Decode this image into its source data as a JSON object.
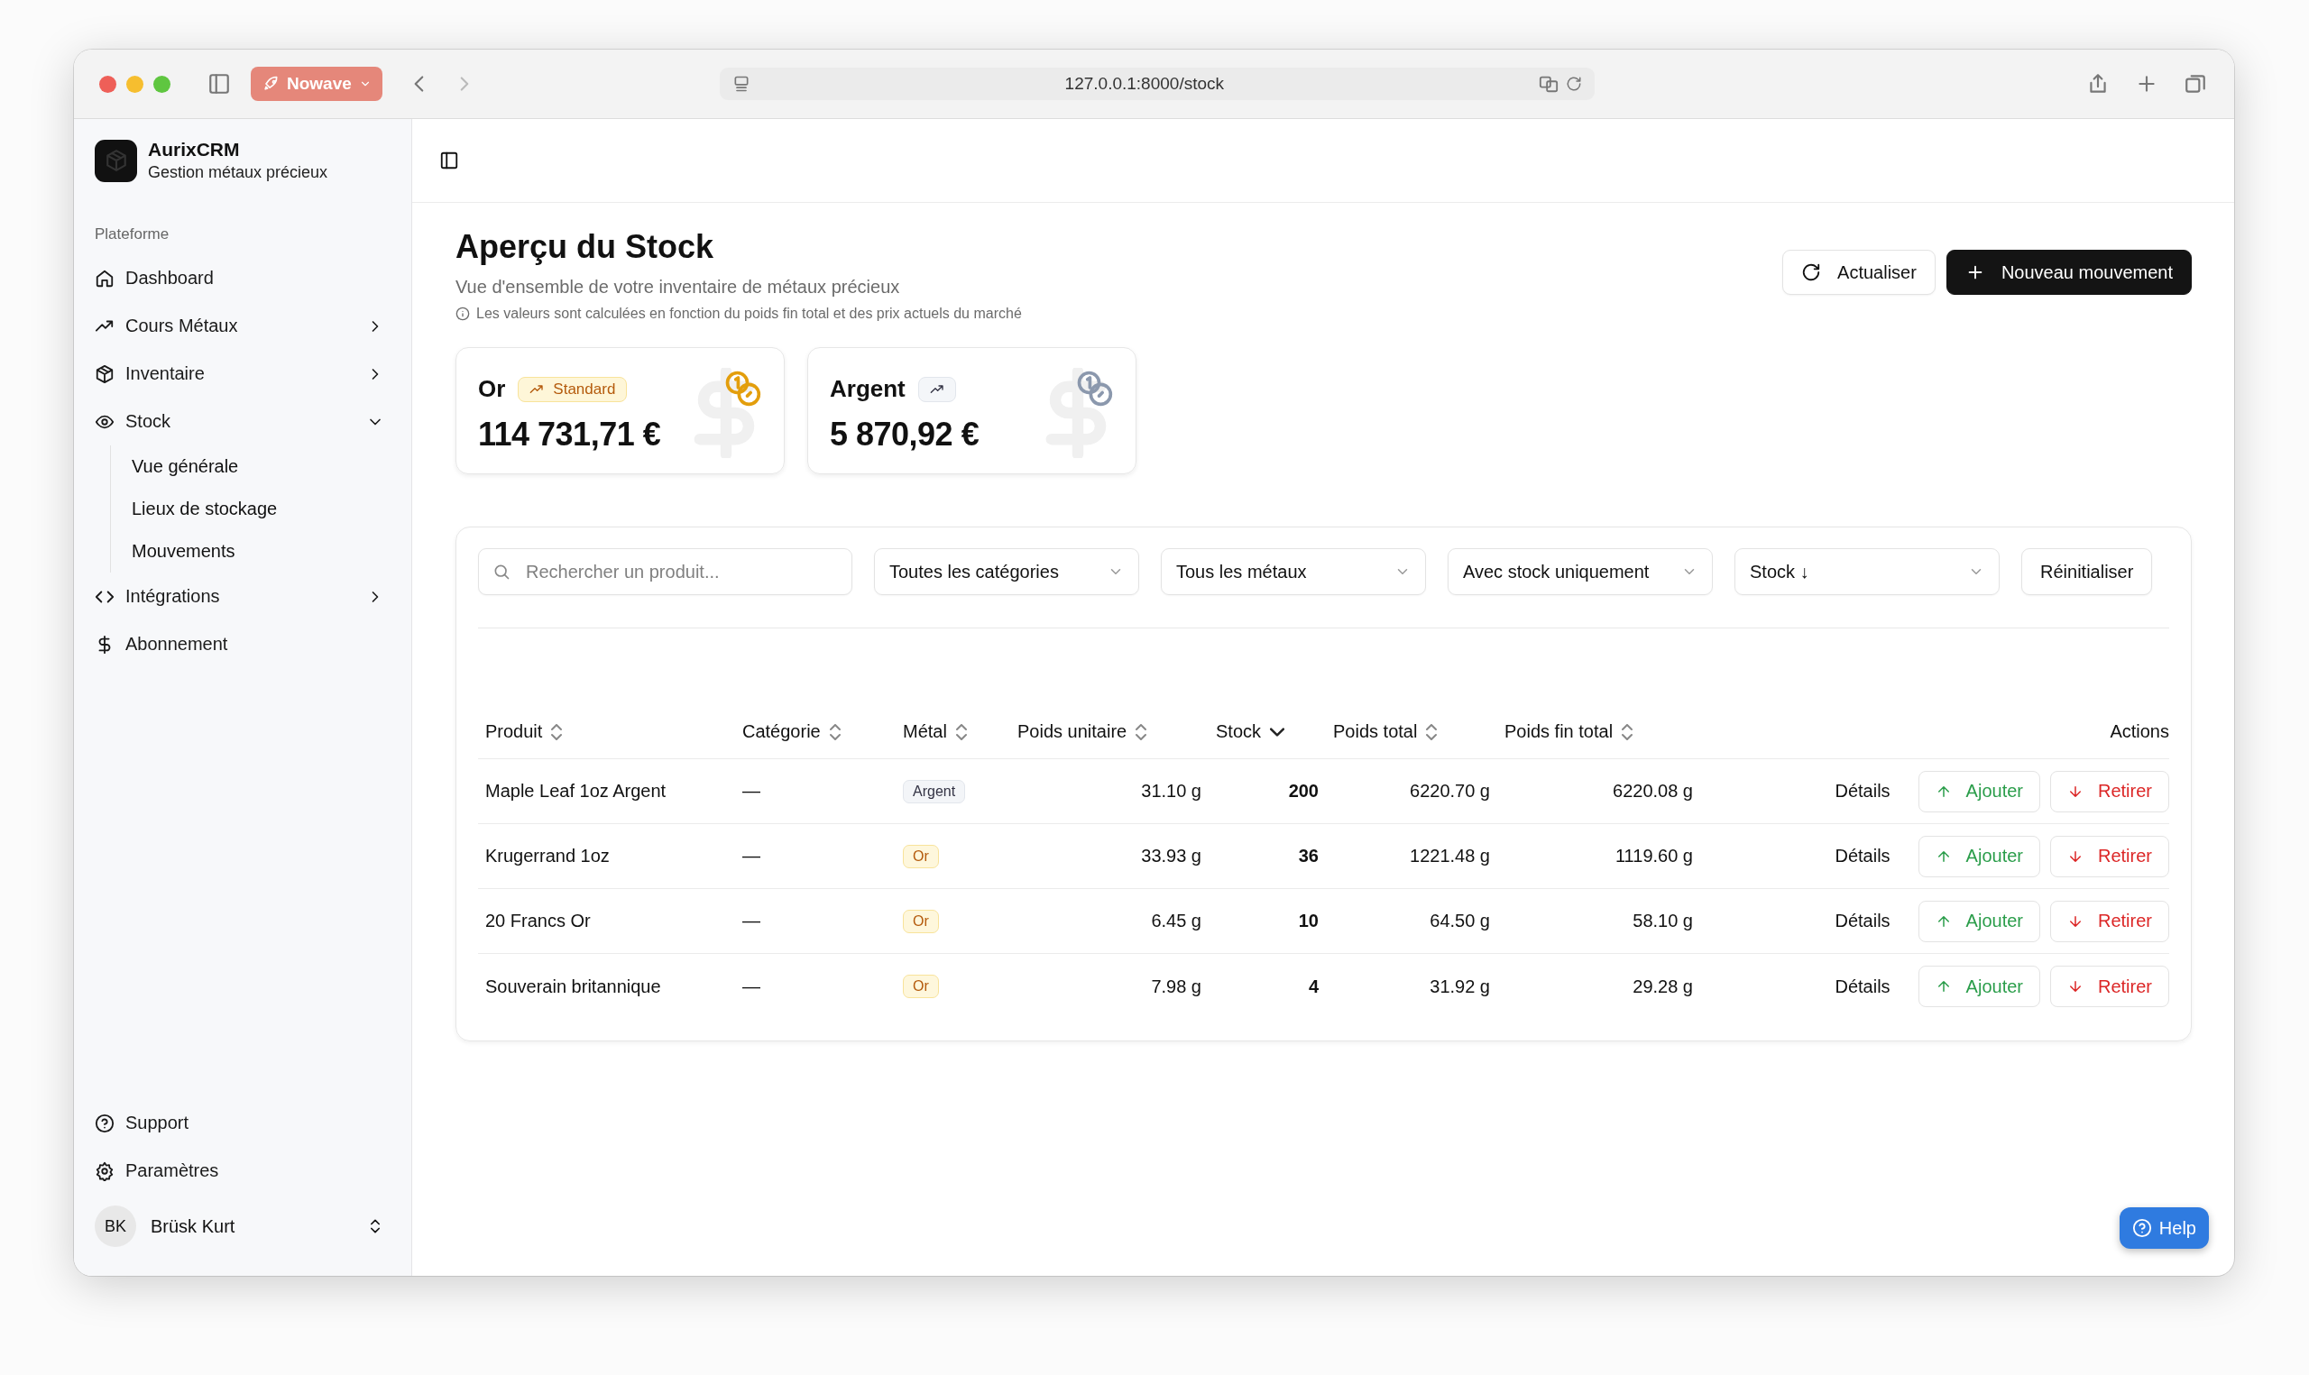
{
  "browser": {
    "tab_group": "Nowave",
    "url": "127.0.0.1:8000/stock"
  },
  "sidebar": {
    "brand": {
      "name": "AurixCRM",
      "subtitle": "Gestion métaux précieux"
    },
    "section_label": "Plateforme",
    "items": [
      {
        "label": "Dashboard"
      },
      {
        "label": "Cours Métaux",
        "expanded": false
      },
      {
        "label": "Inventaire",
        "expanded": false
      },
      {
        "label": "Stock",
        "expanded": true,
        "children": [
          {
            "label": "Vue générale"
          },
          {
            "label": "Lieux de stockage"
          },
          {
            "label": "Mouvements"
          }
        ]
      },
      {
        "label": "Intégrations",
        "expanded": false
      },
      {
        "label": "Abonnement"
      }
    ],
    "footer": [
      {
        "label": "Support"
      },
      {
        "label": "Paramètres"
      }
    ],
    "user": {
      "initials": "BK",
      "name": "Brüsk Kurt"
    }
  },
  "page": {
    "title": "Aperçu du Stock",
    "subtitle": "Vue d'ensemble de votre inventaire de métaux précieux",
    "note": "Les valeurs sont calculées en fonction du poids fin total et des prix actuels du marché",
    "buttons": [
      {
        "label": "Actualiser",
        "kind": "refresh"
      },
      {
        "label": "Nouveau mouvement",
        "kind": "primary"
      }
    ]
  },
  "cards": [
    {
      "metal": "Or",
      "kind": "gold",
      "badge": "Standard",
      "value": "114 731,71 €"
    },
    {
      "metal": "Argent",
      "kind": "silver",
      "value": "5 870,92 €"
    }
  ],
  "filters": {
    "search": {
      "placeholder": "Rechercher un produit..."
    },
    "selects": [
      "Toutes les catégories",
      "Tous les métaux",
      "Avec stock uniquement",
      "Stock ↓"
    ],
    "reset": "Réinitialiser"
  },
  "table": {
    "columns": [
      {
        "label": "Produit",
        "sorted": false
      },
      {
        "label": "Catégorie",
        "sorted": false
      },
      {
        "label": "Métal",
        "sorted": false
      },
      {
        "label": "Poids unitaire",
        "sorted": false
      },
      {
        "label": "Stock",
        "sorted": true
      },
      {
        "label": "Poids total",
        "sorted": false
      },
      {
        "label": "Poids fin total",
        "sorted": false
      },
      {
        "label": "Actions"
      }
    ],
    "rows": [
      {
        "product": "Maple Leaf 1oz Argent",
        "category": "—",
        "metal": {
          "label": "Argent",
          "kind": "silver"
        },
        "unit_weight": "31.10 g",
        "stock": "200",
        "total_weight": "6220.70 g",
        "fine_weight": "6220.08 g",
        "details": "Détails",
        "add": "Ajouter",
        "remove": "Retirer"
      },
      {
        "product": "Krugerrand 1oz",
        "category": "—",
        "metal": {
          "label": "Or",
          "kind": "gold"
        },
        "unit_weight": "33.93 g",
        "stock": "36",
        "total_weight": "1221.48 g",
        "fine_weight": "1119.60 g",
        "details": "Détails",
        "add": "Ajouter",
        "remove": "Retirer"
      },
      {
        "product": "20 Francs Or",
        "category": "—",
        "metal": {
          "label": "Or",
          "kind": "gold"
        },
        "unit_weight": "6.45 g",
        "stock": "10",
        "total_weight": "64.50 g",
        "fine_weight": "58.10 g",
        "details": "Détails",
        "add": "Ajouter",
        "remove": "Retirer"
      },
      {
        "product": "Souverain britannique",
        "category": "—",
        "metal": {
          "label": "Or",
          "kind": "gold"
        },
        "unit_weight": "7.98 g",
        "stock": "4",
        "total_weight": "31.92 g",
        "fine_weight": "29.28 g",
        "details": "Détails",
        "add": "Ajouter",
        "remove": "Retirer"
      }
    ]
  },
  "help": "Help"
}
